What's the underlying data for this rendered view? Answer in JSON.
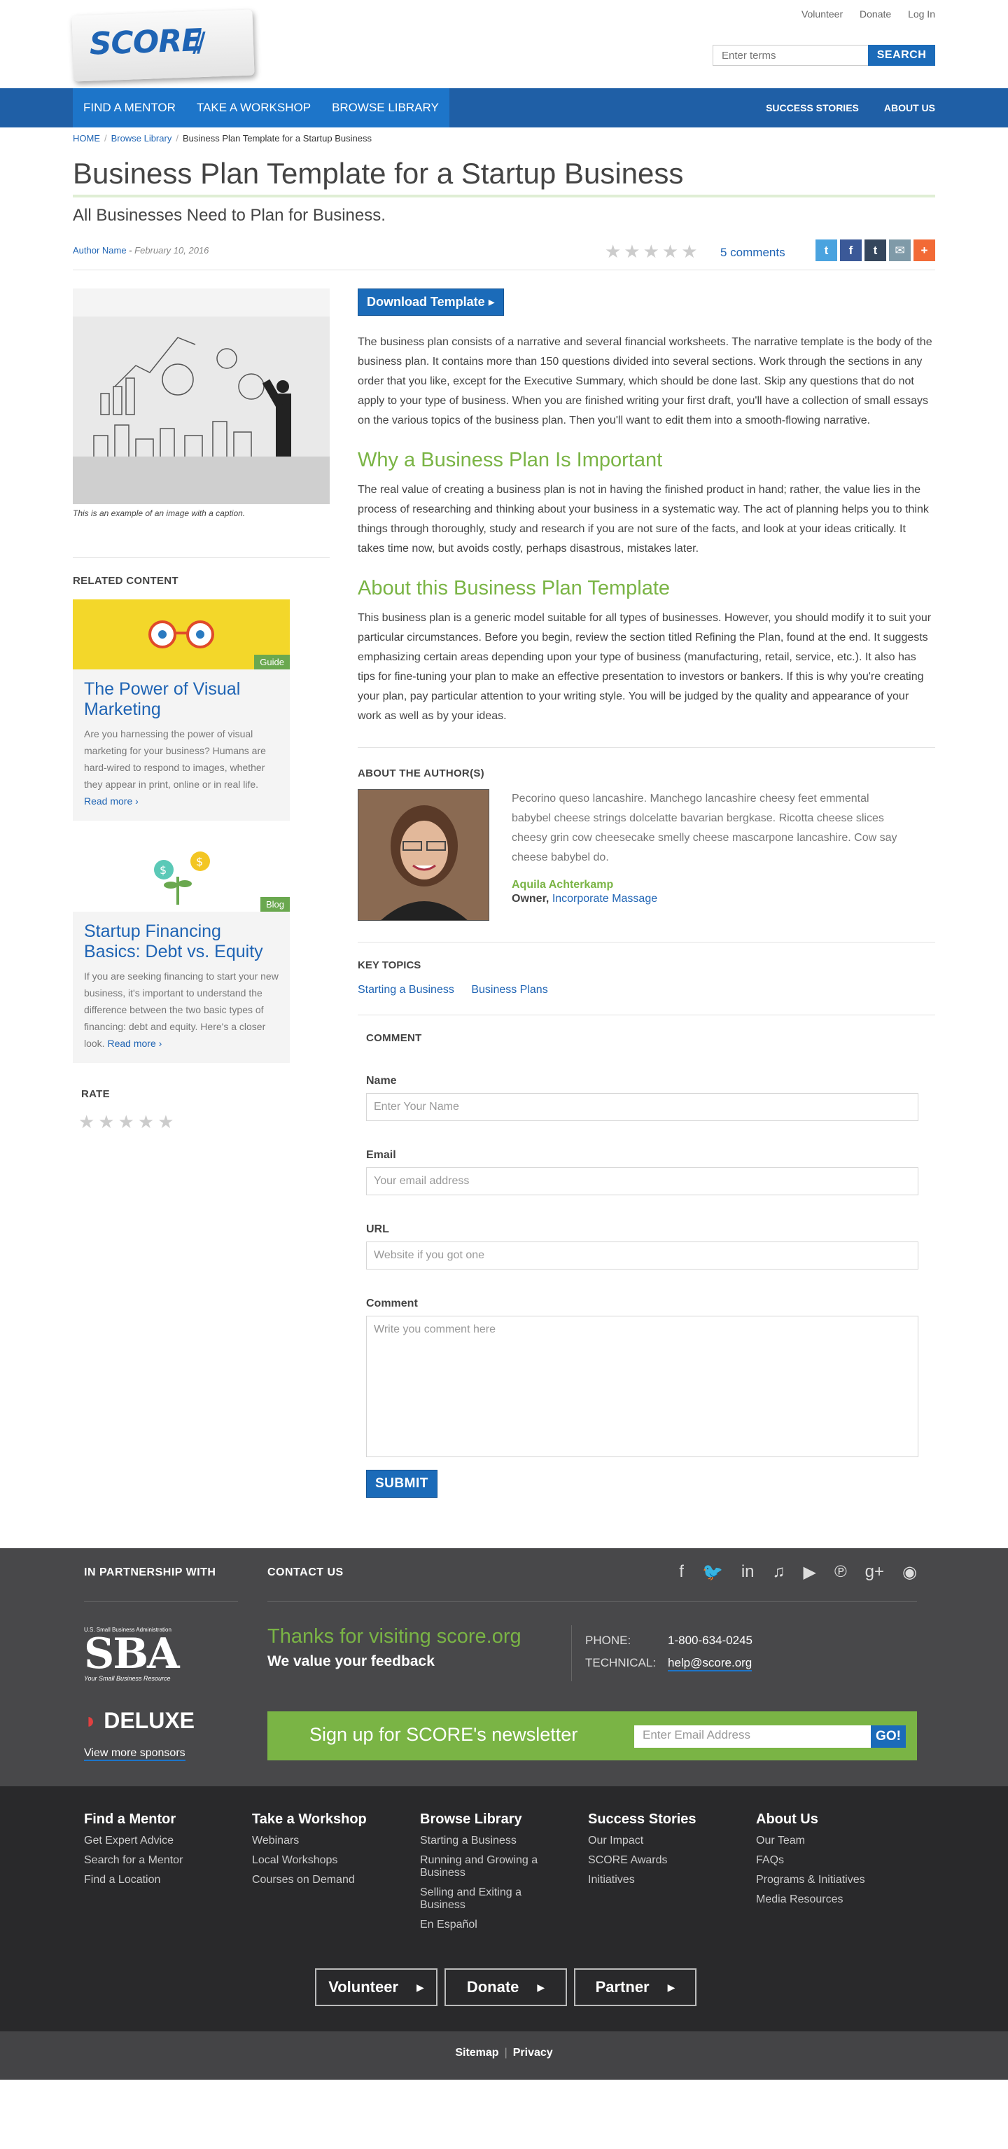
{
  "header": {
    "logo_text": "SCORE",
    "util_links": [
      "Volunteer",
      "Donate",
      "Log In"
    ],
    "search_placeholder": "Enter terms",
    "search_button": "SEARCH"
  },
  "nav": {
    "left": [
      "FIND A MENTOR",
      "TAKE A WORKSHOP",
      "BROWSE LIBRARY"
    ],
    "right": [
      "SUCCESS STORIES",
      "ABOUT US"
    ]
  },
  "breadcrumb": {
    "items": [
      "HOME",
      "Browse Library"
    ],
    "current": "Business Plan Template for a Startup Business"
  },
  "article": {
    "title": "Business Plan Template for a Startup Business",
    "subtitle": "All Businesses Need to Plan for Business.",
    "author": "Author Name",
    "date": "February 10, 2016",
    "stars": "★★★★★",
    "comments": "5 comments",
    "share_icons": [
      "twitter-icon",
      "facebook-icon",
      "tumblr-icon",
      "mail-icon",
      "plus-icon"
    ],
    "image_caption": "This is an example of an image with a caption.",
    "download_label": "Download Template",
    "intro": "The business plan consists of a narrative and several financial worksheets. The narrative template is the body of the business plan. It contains more than 150 questions divided into several sections. Work through the sections in any order that you like, except for the Executive Summary, which should be done last. Skip any questions that do not apply to your type of business. When you are finished writing your first draft, you'll have a collection of small essays on the various topics of the business plan. Then you'll want to edit them into a smooth-flowing narrative.",
    "section1_title": "Why a Business Plan Is Important",
    "section1_text": "The real value of creating a business plan is not in having the finished product in hand; rather, the value lies in the process of researching and thinking about your business in a systematic way. The act of planning helps you to think things through thoroughly, study and research if you are not sure of the facts, and look at your ideas critically. It takes time now, but avoids costly, perhaps disastrous, mistakes later.",
    "section2_title": "About this Business Plan Template",
    "section2_text": "This business plan is a generic model suitable for all types of businesses. However, you should modify it to suit your particular circumstances. Before you begin, review the section titled Refining the Plan, found at the end. It suggests emphasizing certain areas depending upon your type of business (manufacturing, retail, service, etc.). It also has tips for fine-tuning your plan to make an effective presentation to investors or bankers. If this is why you're creating your plan, pay particular attention to your writing style. You will be judged by the quality and appearance of your work as well as by your ideas."
  },
  "about_author": {
    "heading": "ABOUT THE AUTHOR(S)",
    "bio": "Pecorino queso lancashire. Manchego lancashire cheesy feet emmental babybel cheese strings dolcelatte bavarian bergkase. Ricotta cheese slices cheesy grin cow cheesecake smelly cheese mascarpone lancashire. Cow say cheese babybel do.",
    "name": "Aquila Achterkamp",
    "role": "Owner,",
    "company": "Incorporate Massage"
  },
  "key_topics": {
    "heading": "KEY TOPICS",
    "items": [
      "Starting a Business",
      "Business Plans"
    ]
  },
  "related": {
    "heading": "RELATED CONTENT",
    "cards": [
      {
        "badge": "Guide",
        "title": "The Power of Visual Marketing",
        "text": "Are you harnessing the power of visual marketing for your business? Humans are hard-wired to respond to images, whether they appear in print, online or in real life.",
        "more": "Read more ›"
      },
      {
        "badge": "Blog",
        "title": "Startup Financing Basics: Debt vs. Equity",
        "text": "If you are seeking financing to start your new business, it's important to understand the difference between the two basic types of financing: debt and equity. Here's a closer look.",
        "more": "Read more ›"
      }
    ]
  },
  "rate": {
    "heading": "RATE",
    "stars": "★★★★★"
  },
  "comment_form": {
    "heading": "COMMENT",
    "name_label": "Name",
    "name_placeholder": "Enter Your Name",
    "email_label": "Email",
    "email_placeholder": "Your email address",
    "url_label": "URL",
    "url_placeholder": "Website if you got one",
    "comment_label": "Comment",
    "comment_placeholder": "Write you comment here",
    "submit": "SUBMIT"
  },
  "footer": {
    "partnership_heading": "IN PARTNERSHIP WITH",
    "contact_heading": "CONTACT US",
    "sba_small": "U.S. Small Business Administration",
    "sba_logo": "SBA",
    "sba_tag": "Your Small Business Resource",
    "deluxe_logo": "DELUXE",
    "more_sponsors": "View more sponsors",
    "thanks": "Thanks for visiting score.org",
    "feedback": "We value your feedback",
    "phone_label": "PHONE:",
    "phone": "1-800-634-0245",
    "technical_label": "TECHNICAL:",
    "technical": "help@score.org",
    "newsletter": "Sign up for SCORE's newsletter",
    "newsletter_placeholder": "Enter Email Address",
    "newsletter_go": "GO!",
    "columns": [
      {
        "title": "Find a Mentor",
        "links": [
          "Get Expert Advice",
          "Search for a Mentor",
          "Find a Location"
        ]
      },
      {
        "title": "Take a Workshop",
        "links": [
          "Webinars",
          "Local Workshops",
          "Courses on Demand"
        ]
      },
      {
        "title": "Browse Library",
        "links": [
          "Starting a Business",
          "Running and Growing a Business",
          "Selling and Exiting a Business",
          "En Español"
        ]
      },
      {
        "title": "Success Stories",
        "links": [
          "Our Impact",
          "SCORE Awards",
          "Initiatives"
        ]
      },
      {
        "title": "About Us",
        "links": [
          "Our Team",
          "FAQs",
          "Programs & Initiatives",
          "Media Resources"
        ]
      }
    ],
    "cta": [
      "Volunteer",
      "Donate",
      "Partner"
    ],
    "bottom": [
      "Sitemap",
      "Privacy"
    ]
  },
  "colors": {
    "brand_blue": "#1f64b4",
    "nav_blue": "#1f5fa6",
    "accent_green": "#7ab445",
    "footer_dark": "#48484a"
  }
}
